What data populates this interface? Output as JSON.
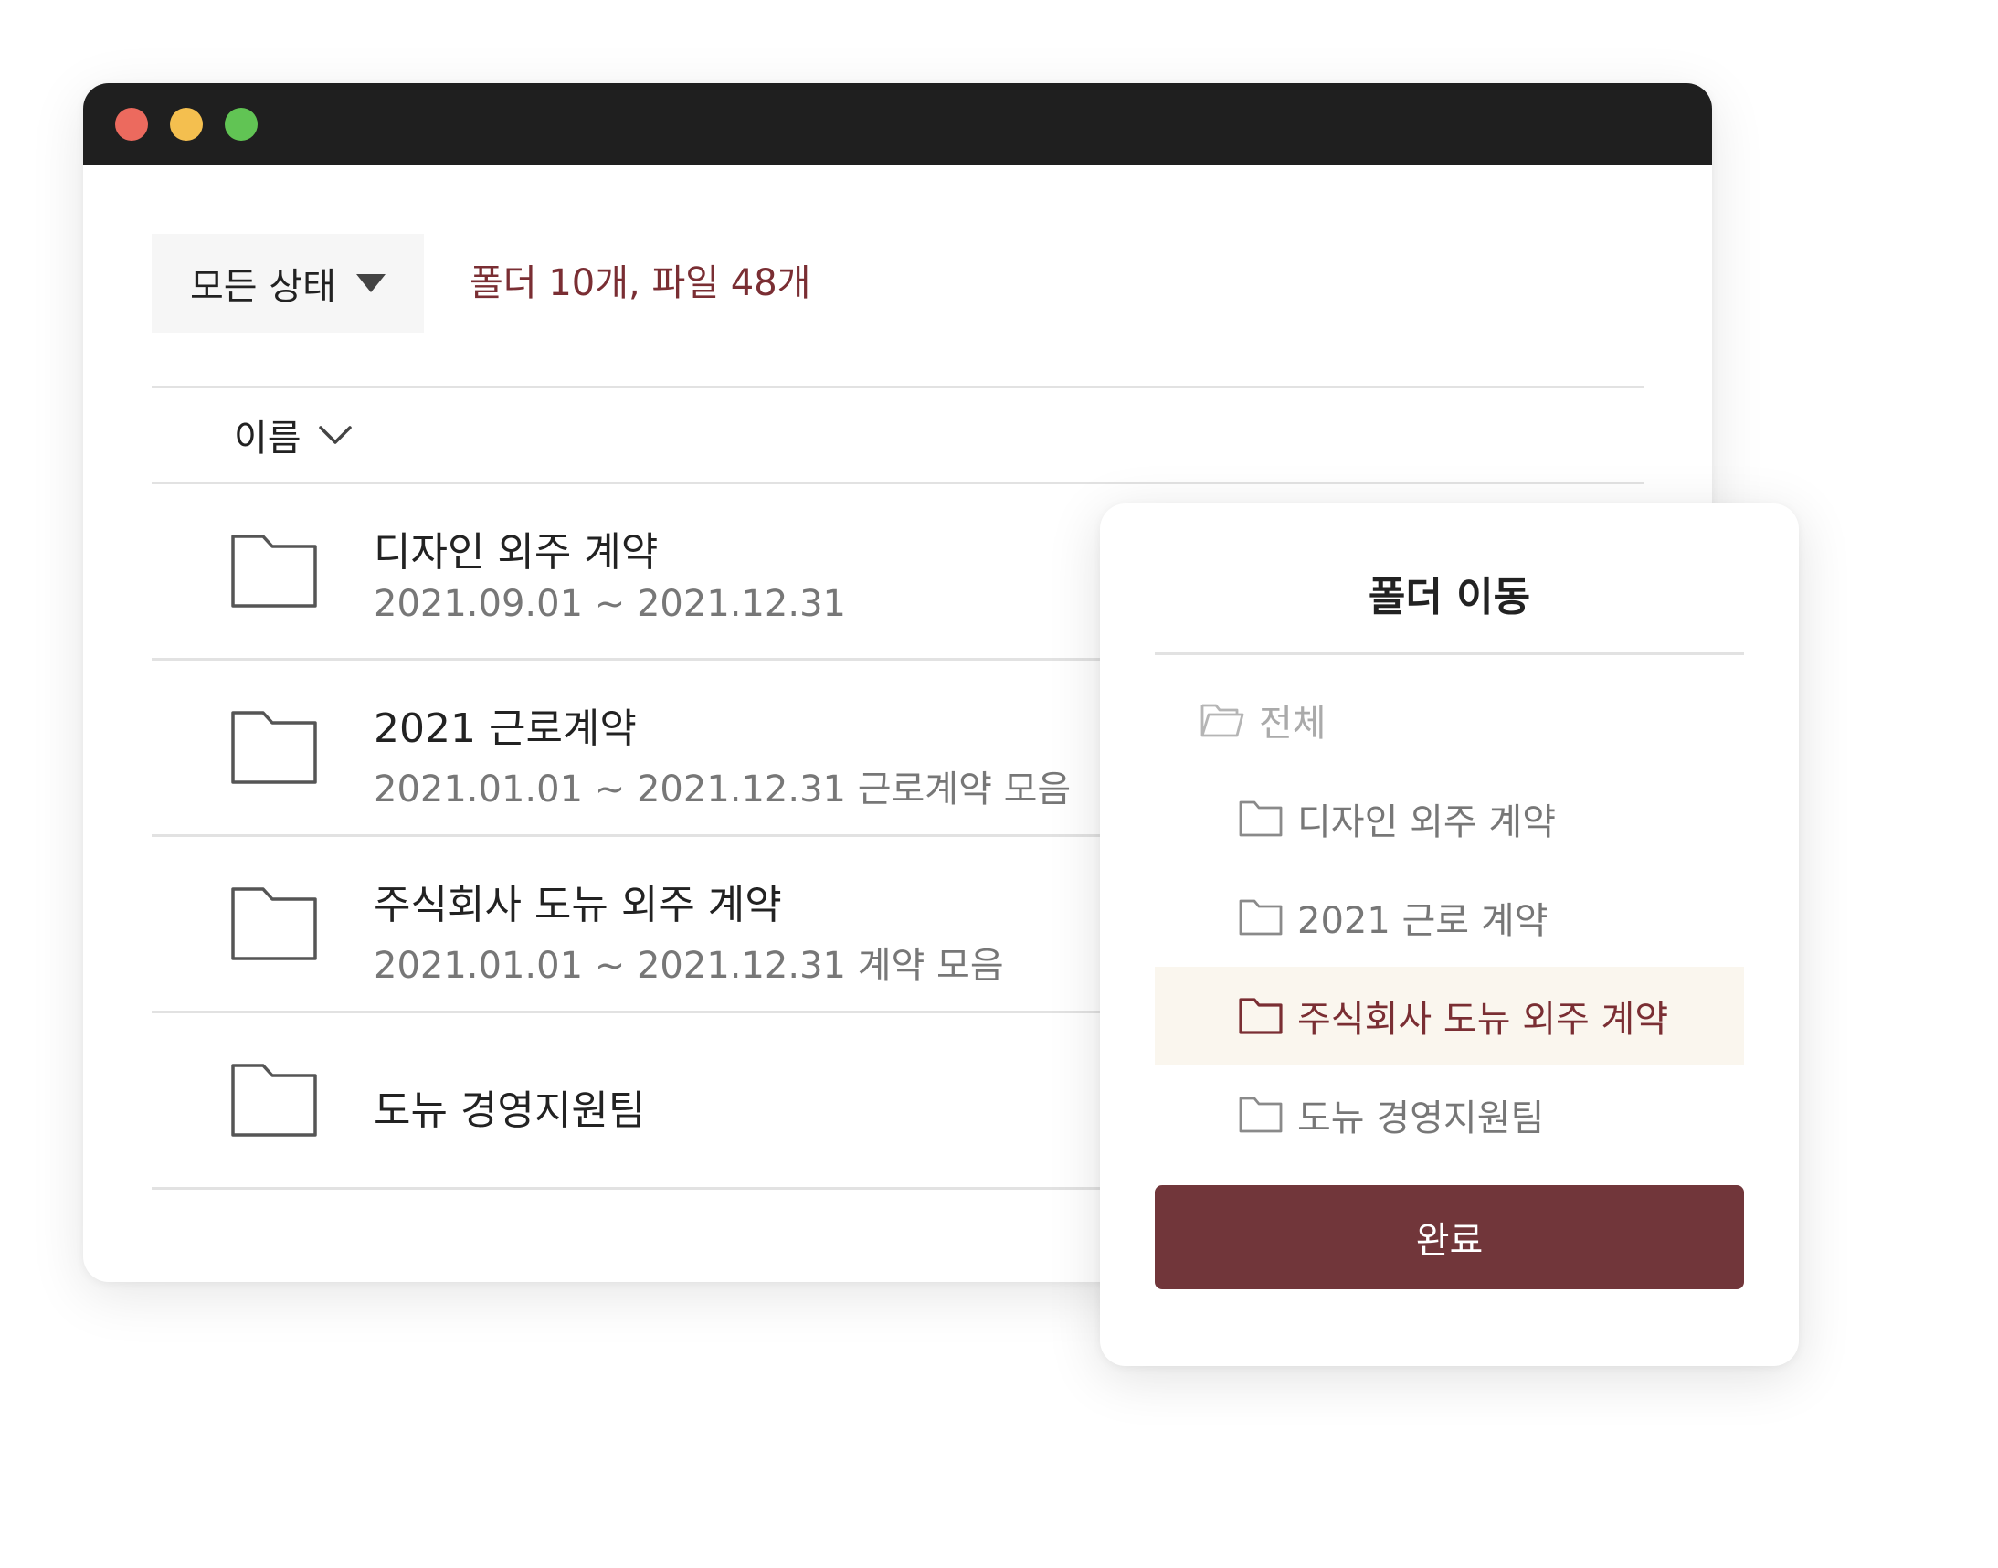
{
  "window": {
    "controls": [
      "close",
      "minimize",
      "maximize"
    ]
  },
  "toolbar": {
    "status_filter_label": "모든 상태",
    "count_text": "폴더 10개, 파일 48개"
  },
  "list": {
    "sort_label": "이름",
    "rows": [
      {
        "title": "디자인 외주 계약",
        "subtitle": "2021.09.01 ~ 2021.12.31"
      },
      {
        "title": "2021 근로계약",
        "subtitle": "2021.01.01 ~ 2021.12.31 근로계약 모음"
      },
      {
        "title": "주식회사 도뉴 외주 계약",
        "subtitle": "2021.01.01 ~ 2021.12.31 계약 모음"
      },
      {
        "title": "도뉴 경영지원팀",
        "subtitle": ""
      }
    ]
  },
  "dialog": {
    "title": "폴더 이동",
    "root_label": "전체",
    "folders": [
      {
        "label": "디자인 외주 계약",
        "selected": false
      },
      {
        "label": "2021 근로 계약",
        "selected": false
      },
      {
        "label": "주식회사 도뉴 외주 계약",
        "selected": true
      },
      {
        "label": "도뉴 경영지원팀",
        "selected": false
      }
    ],
    "done_label": "완료"
  },
  "colors": {
    "accent": "#7a2e33",
    "button": "#71363a",
    "selected_bg": "#faf6ee",
    "titlebar": "#1f1f1f"
  },
  "icons": [
    "folder-icon",
    "open-folder-icon",
    "chevron-down-icon",
    "caret-down-icon"
  ]
}
